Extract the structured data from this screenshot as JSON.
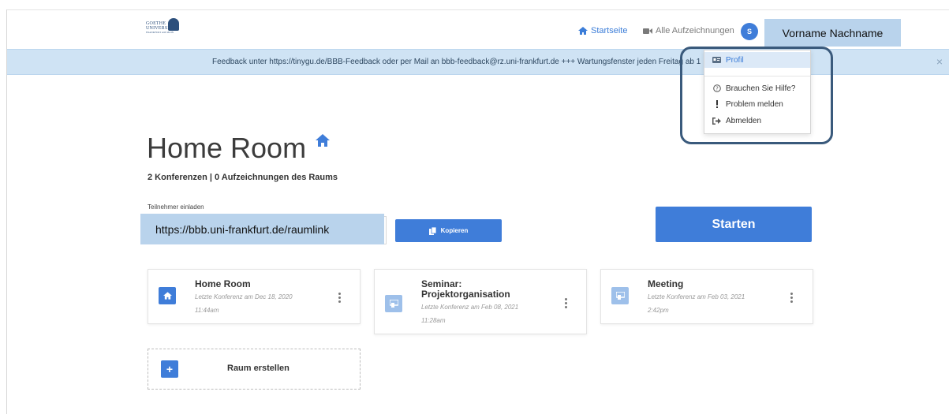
{
  "header": {
    "logo": {
      "line1": "GOETHE",
      "line2": "UNIVERSITÄT",
      "line3": "FRANKFURT AM MAIN"
    },
    "nav": {
      "home": "Startseite",
      "recordings": "Alle Aufzeichnungen"
    },
    "avatar_initial": "S",
    "user_name": "Vorname Nachname"
  },
  "banner": {
    "text": "Feedback unter https://tinygu.de/BBB-Feedback oder per Mail an bbb-feedback@rz.uni-frankfurt.de +++ Wartungsfenster jeden Freitag ab 1",
    "close": "×"
  },
  "main": {
    "title": "Home Room",
    "subtitle": "2 Konferenzen | 0 Aufzeichnungen des Raums",
    "invite_label": "Teilnehmer einladen",
    "invite_link": "https://bbb.uni-frankfurt.de/raumlink",
    "copy_label": "Kopieren",
    "start_label": "Starten"
  },
  "rooms": [
    {
      "name": "Home Room",
      "meta1": "Letzte Konferenz am Dec 18, 2020",
      "meta2": "11:44am",
      "icon": "home-icon"
    },
    {
      "name1": "Seminar:",
      "name2": "Projektorganisation",
      "meta1": "Letzte Konferenz am Feb 08, 2021",
      "meta2": "11:28am",
      "icon": "room-icon"
    },
    {
      "name": "Meeting",
      "meta1": "Letzte Konferenz am Feb 03, 2021",
      "meta2": "2:42pm",
      "icon": "room-icon"
    }
  ],
  "create_room": {
    "label": "Raum erstellen",
    "plus": "+"
  },
  "dropdown": {
    "items": [
      "Profil",
      "Brauchen Sie Hilfe?",
      "Problem melden",
      "Abmelden"
    ]
  },
  "colors": {
    "accent": "#3f7dd9",
    "highlight_overlay": "#b9d3ec",
    "banner": "#cfe3f4",
    "callout_border": "#3a5a7c"
  }
}
